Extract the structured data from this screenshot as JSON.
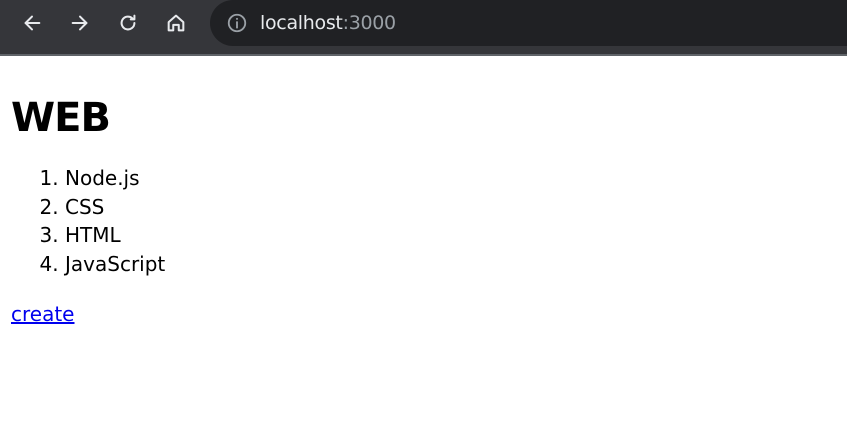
{
  "browser": {
    "url_host": "localhost",
    "url_port": ":3000"
  },
  "page": {
    "title": "WEB",
    "list": [
      "Node.js",
      "CSS",
      "HTML",
      "JavaScript"
    ],
    "create_link": "create"
  }
}
